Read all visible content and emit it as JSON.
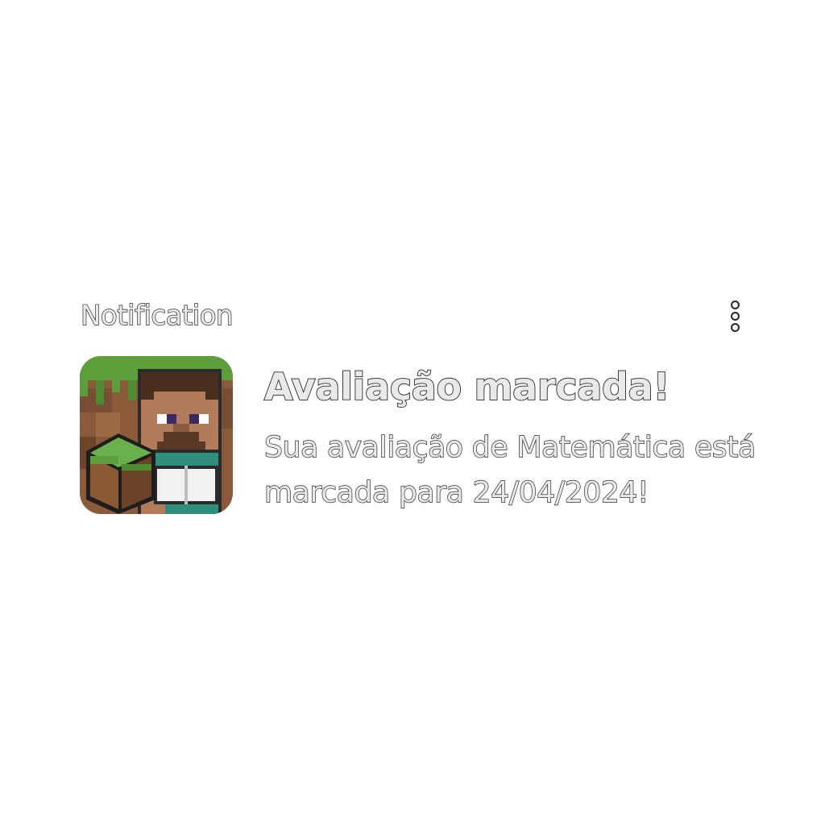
{
  "notification": {
    "header_label": "Notification",
    "menu_icon": "more-vertical-icon",
    "app_icon": "minecraft-education-icon",
    "title": "Avaliação marcada!",
    "body": "Sua avaliação de Matemática está marcada para 24/04/2024!"
  },
  "colors": {
    "background": "#ffffff",
    "text_fill": "#e9e9e9",
    "text_outline": "#2a2a2a"
  }
}
